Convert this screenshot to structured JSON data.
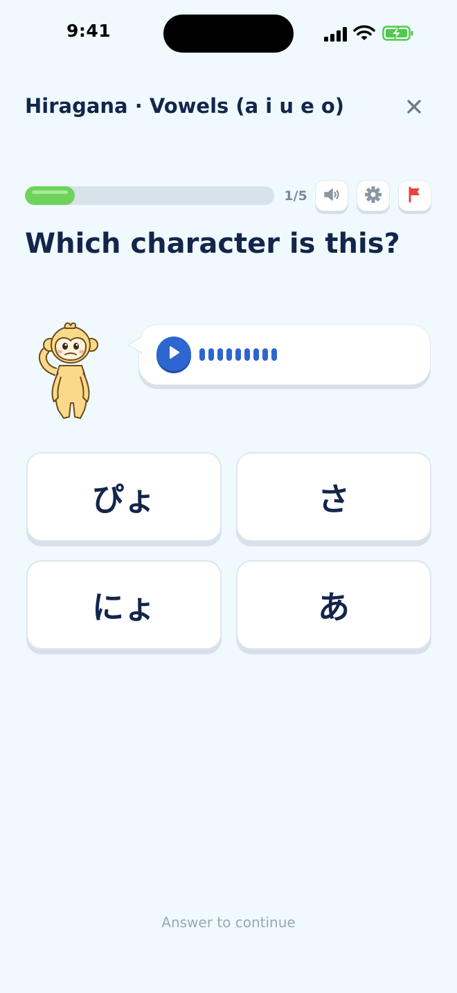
{
  "status_bar": {
    "time": "9:41",
    "icons": [
      "cellular-signal-icon",
      "wifi-icon",
      "battery-charging-icon"
    ]
  },
  "header": {
    "title": "Hiragana · Vowels (a i u e o)",
    "close_icon": "close-icon"
  },
  "progress": {
    "count_label": "1/5",
    "fraction": 0.2,
    "tools": [
      "speaker-icon",
      "gear-icon",
      "flag-icon"
    ]
  },
  "question": {
    "prompt": "Which character is this?"
  },
  "audio": {
    "play_icon": "play-icon"
  },
  "answers": [
    {
      "label": "ぴょ"
    },
    {
      "label": "さ"
    },
    {
      "label": "にょ"
    },
    {
      "label": "あ"
    }
  ],
  "footer": {
    "hint": "Answer to continue"
  },
  "colors": {
    "background": "#eff9fe",
    "text": "#13254a",
    "progress_fill": "#6fd35b",
    "accent_blue": "#2d66d0",
    "flag_red": "#e8453c",
    "battery_green": "#53c94b"
  }
}
